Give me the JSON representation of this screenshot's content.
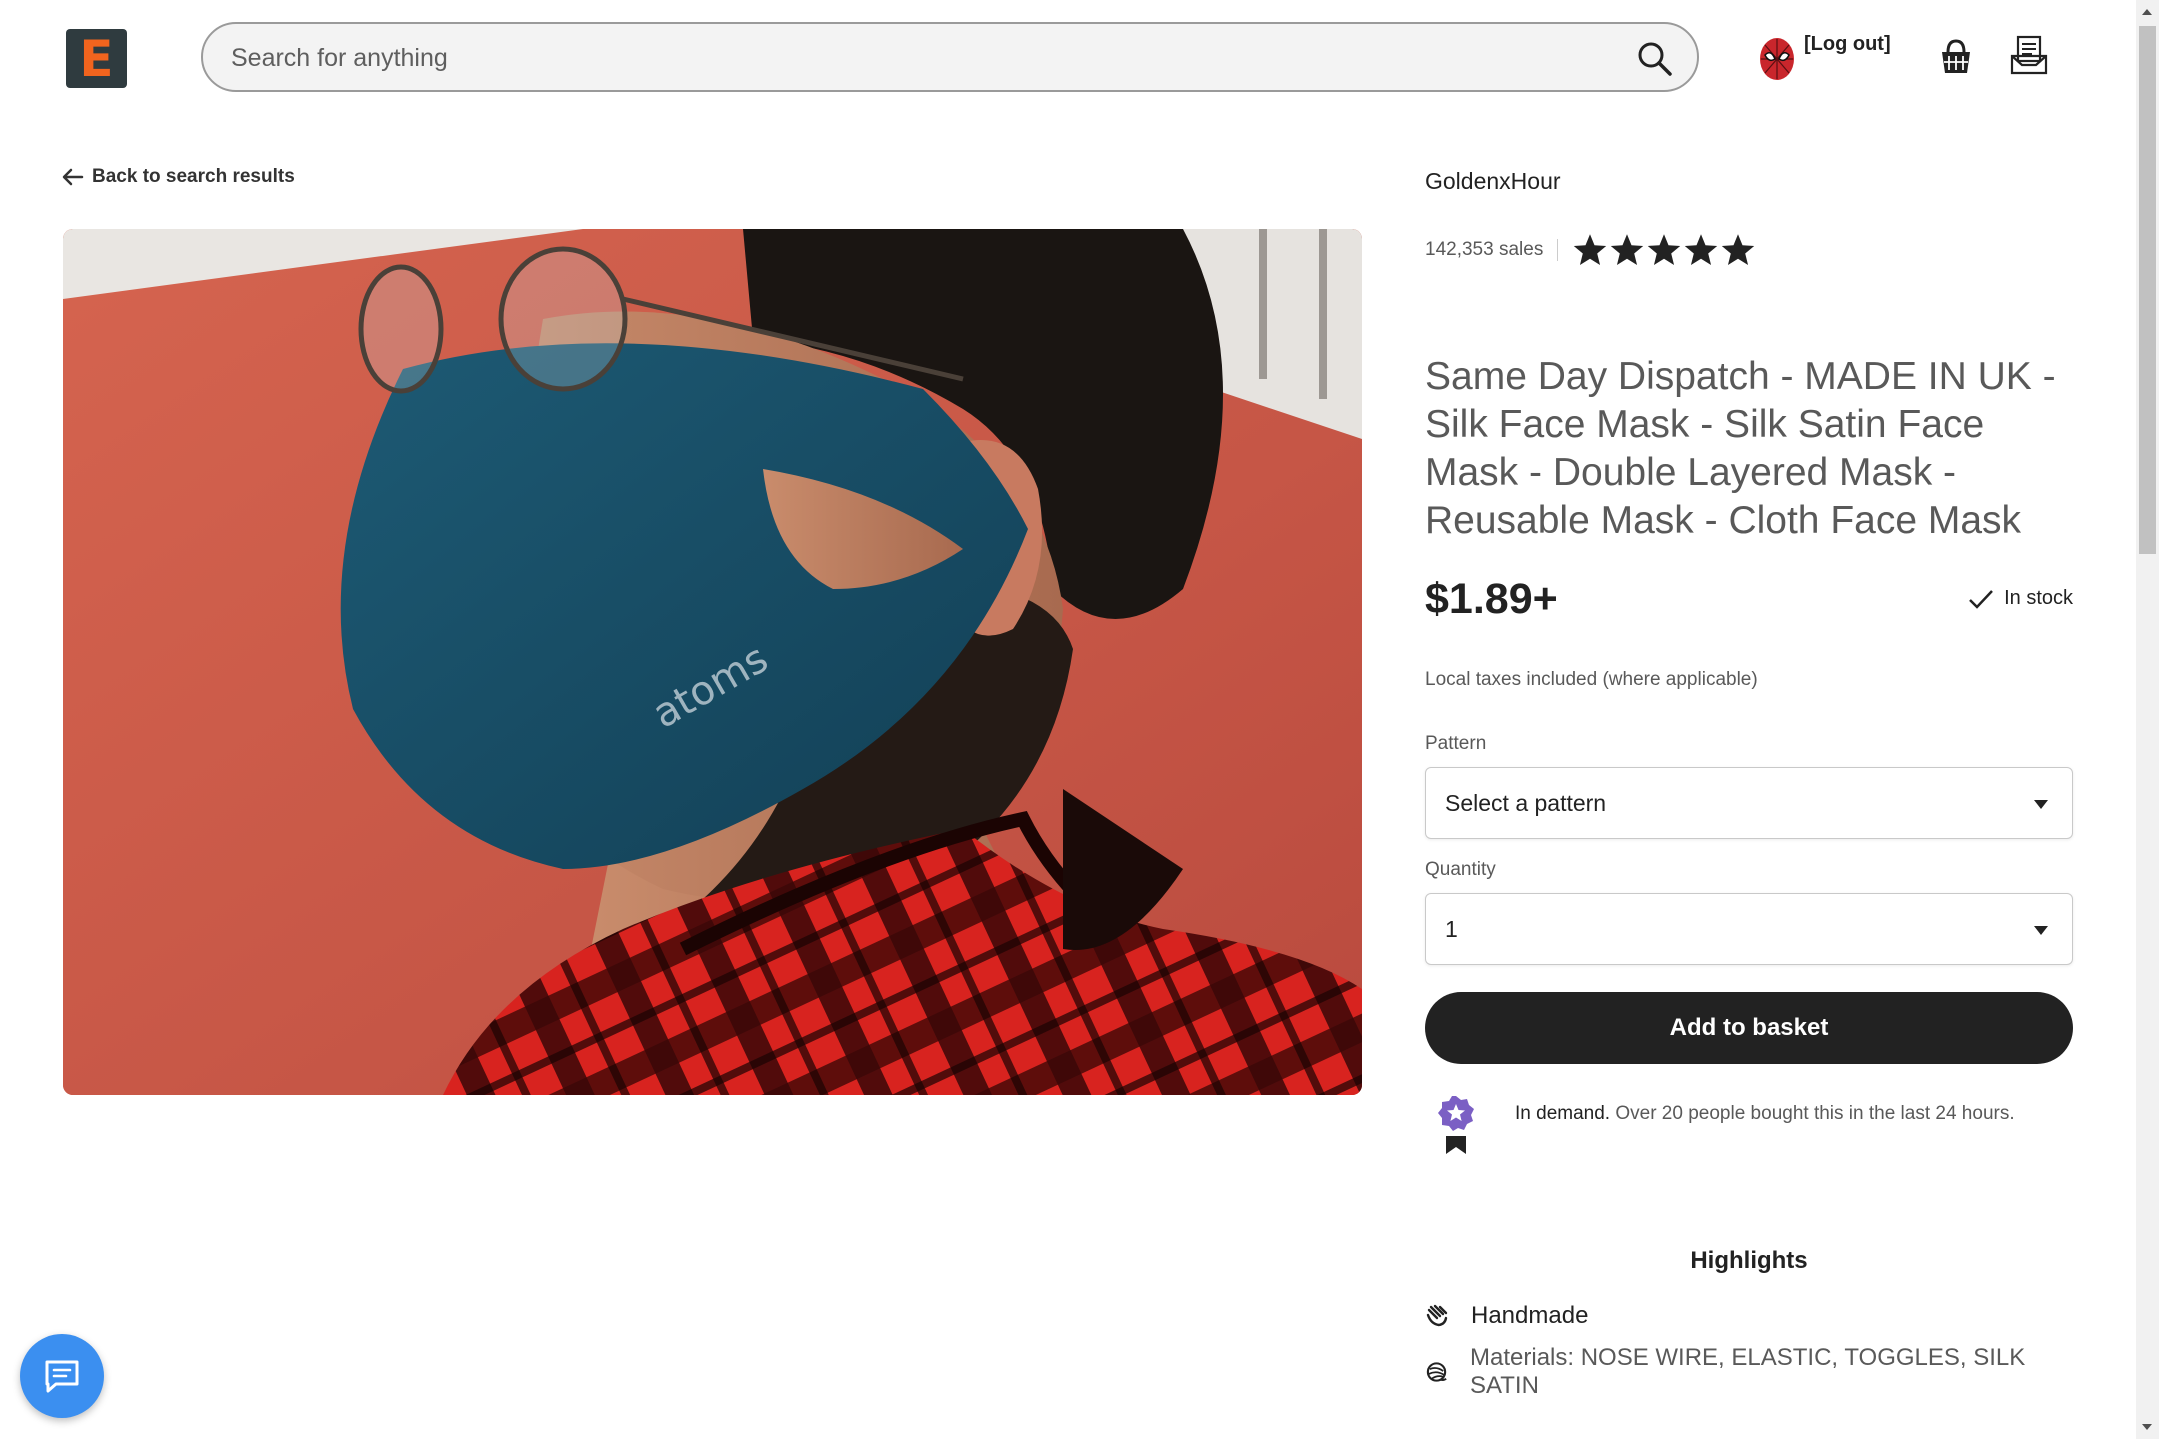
{
  "header": {
    "logo_letter": "E",
    "search_placeholder": "Search for anything",
    "logout_label": "[Log out]"
  },
  "nav": {
    "back_label": "Back to search results"
  },
  "product": {
    "image_caption": "atoms",
    "shop_name": "GoldenxHour",
    "sales": "142,353 sales",
    "rating_stars": 5,
    "title": "Same Day Dispatch - MADE IN UK - Silk Face Mask - Silk Satin Face Mask - Double Layered Mask - Reusable Mask - Cloth Face Mask",
    "price": "$1.89+",
    "stock": "In stock",
    "taxes": "Local taxes included (where applicable)",
    "pattern_label": "Pattern",
    "pattern_value": "Select a pattern",
    "quantity_label": "Quantity",
    "quantity_value": "1",
    "add_button": "Add to basket",
    "demand_bold": "In demand.",
    "demand_text": " Over 20 people bought this in the last 24 hours.",
    "highlights_title": "Highlights",
    "highlight_handmade": "Handmade",
    "highlight_materials": "Materials: NOSE WIRE, ELASTIC, TOGGLES, SILK SATIN"
  },
  "colors": {
    "brand_orange": "#f1641e",
    "button_dark": "#222222",
    "chat_blue": "#3b8ff0",
    "badge_purple": "#7b5fc4"
  },
  "icons": [
    "search-icon",
    "avatar-icon",
    "basket-icon",
    "account-icon",
    "arrow-left-icon",
    "star-icon",
    "check-icon",
    "caret-down-icon",
    "award-icon",
    "hand-icon",
    "materials-icon",
    "chat-icon"
  ]
}
